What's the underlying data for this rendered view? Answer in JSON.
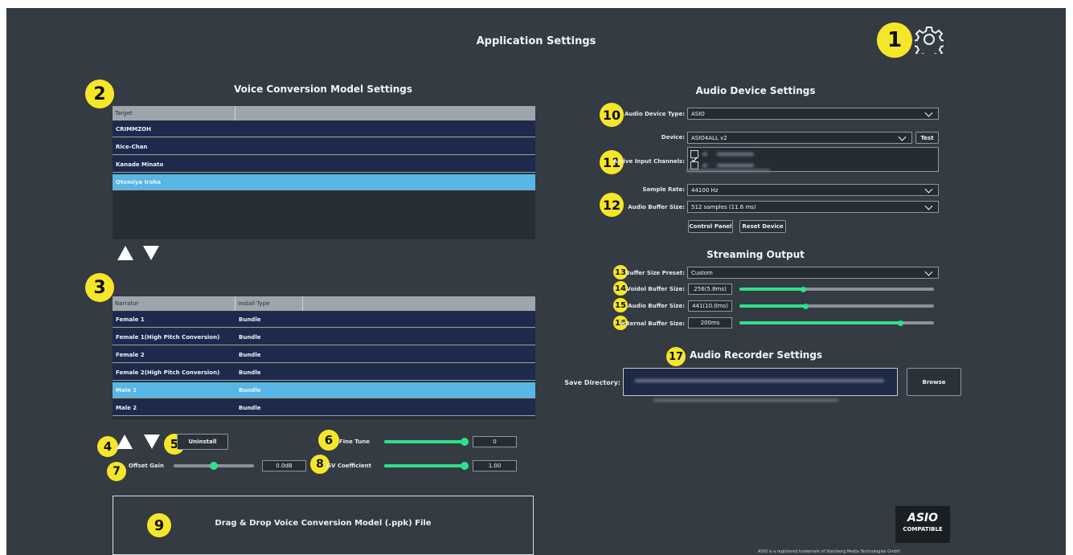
{
  "app": {
    "title": "Application Settings",
    "settings_icon": "gear-icon"
  },
  "colors": {
    "panel": "#343b42",
    "badge": "#f6e62a",
    "row": "#1d2a4e",
    "row_selected": "#56b6e6",
    "slider": "#2fe08a"
  },
  "badges": [
    "1",
    "2",
    "3",
    "4",
    "5",
    "6",
    "7",
    "8",
    "9",
    "10",
    "11",
    "12",
    "13",
    "14",
    "15",
    "16",
    "17"
  ],
  "vc": {
    "title": "Voice Conversion Model Settings",
    "target_header": "Target",
    "targets": [
      "CRIMMZOH",
      "Rice-Chan",
      "Kanade Minato",
      "Otomiya Iroha"
    ],
    "selected_target_index": 3,
    "narrator_header": "Narrator",
    "install_header": "Install Type",
    "narrators": [
      {
        "name": "Female 1",
        "install": "Bundle"
      },
      {
        "name": "Female 1(High Pitch Conversion)",
        "install": "Bundle"
      },
      {
        "name": "Female 2",
        "install": "Bundle"
      },
      {
        "name": "Female 2(High Pitch Conversion)",
        "install": "Bundle"
      },
      {
        "name": "Male 1",
        "install": "Bundle"
      },
      {
        "name": "Male 2",
        "install": "Bundle"
      }
    ],
    "selected_narrator_index": 4,
    "uninstall_label": "Uninstall",
    "fine_tune_label": "Fine Tune",
    "fine_tune_value": "0",
    "fine_tune_level": 1.0,
    "offset_gain_label": "Offset Gain",
    "offset_gain_value": "0.0dB",
    "offset_gain_level": 0.5,
    "gv_label": "GV Coefficient",
    "gv_value": "1.00",
    "gv_level": 1.0,
    "drop_label": "Drag & Drop Voice Conversion Model (.ppk) File"
  },
  "audio": {
    "title": "Audio Device Settings",
    "device_type_label": "Audio Device Type:",
    "device_type_value": "ASIO",
    "device_label": "Device:",
    "device_value": "ASIO4ALL v2",
    "test_label": "Test",
    "input_channels_label": "Active Input Channels:",
    "sample_rate_label": "Sample Rate:",
    "sample_rate_value": "44100 Hz",
    "buffer_size_label": "Audio Buffer Size:",
    "buffer_size_value": "512 samples (11.6 ms)",
    "control_panel_label": "Control Panel",
    "reset_device_label": "Reset Device"
  },
  "streaming": {
    "title": "Streaming Output",
    "preset_label": "Buffer Size Preset:",
    "preset_value": "Custom",
    "voidol_label": "Voidol Buffer Size:",
    "voidol_value": "256(5.8ms)",
    "voidol_level": 0.33,
    "audio_label": "Audio Buffer Size:",
    "audio_value": "441(10.0ms)",
    "audio_level": 0.34,
    "internal_label": "Internal Buffer Size:",
    "internal_value": "200ms",
    "internal_level": 0.83
  },
  "recorder": {
    "title": "Audio Recorder Settings",
    "save_dir_label": "Save Directory:",
    "browse_label": "Browse"
  },
  "asio": {
    "logo_text": "ASIO",
    "compatible": "COMPATIBLE",
    "trademark": "ASIO is a registered trademark of Steinberg Media Technologies GmbH"
  }
}
